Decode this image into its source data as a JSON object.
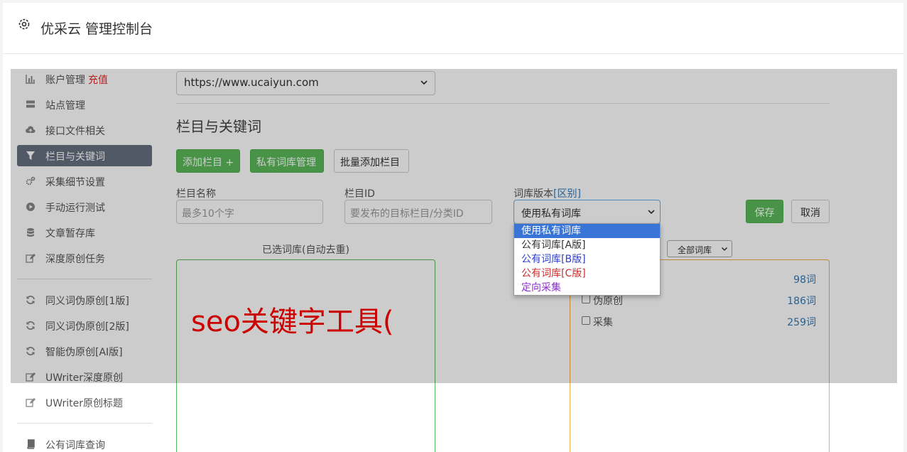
{
  "app": {
    "title": "优采云 管理控制台"
  },
  "sidebar": {
    "group1": [
      {
        "label": "账户管理",
        "badge": "充值",
        "icon": "bar-chart-icon"
      },
      {
        "label": "站点管理",
        "icon": "server-icon"
      },
      {
        "label": "接口文件相关",
        "icon": "cloud-upload-icon"
      },
      {
        "label": "栏目与关键词",
        "icon": "filter-icon",
        "active": true
      },
      {
        "label": "采集细节设置",
        "icon": "cogs-icon"
      },
      {
        "label": "手动运行测试",
        "icon": "play-circle-icon"
      },
      {
        "label": "文章暂存库",
        "icon": "database-icon"
      },
      {
        "label": "深度原创任务",
        "icon": "edit-icon"
      }
    ],
    "group2": [
      {
        "label": "同义词伪原创[1版]",
        "icon": "refresh-icon"
      },
      {
        "label": "同义词伪原创[2版]",
        "icon": "refresh-icon"
      },
      {
        "label": "智能伪原创[AI版]",
        "icon": "refresh-icon"
      },
      {
        "label": "UWriter深度原创",
        "icon": "edit-icon"
      },
      {
        "label": "UWriter原创标题",
        "icon": "edit-icon"
      }
    ],
    "group3": [
      {
        "label": "公有词库查询",
        "icon": "book-icon"
      }
    ]
  },
  "main": {
    "site_select": "https://www.ucaiyun.com",
    "section_title": "栏目与关键词",
    "buttons": {
      "add_column": "添加栏目 +",
      "private_lib": "私有词库管理",
      "batch_add": "批量添加栏目",
      "save": "保存",
      "cancel": "取消"
    },
    "form": {
      "name_label": "栏目名称",
      "name_placeholder": "最多10个字",
      "id_label": "栏目ID",
      "id_placeholder": "要发布的目标栏目/分类ID",
      "lib_label": "词库版本",
      "lib_label_link": "[区别]",
      "lib_selected": "使用私有词库"
    },
    "dropdown_options": [
      "使用私有词库",
      "公有词库[A版]",
      "公有词库[B版]",
      "公有词库[C版]",
      "定向采集"
    ],
    "left_panel_title": "已选词库(自动去重)",
    "overlay_text": "seo关键字工具(",
    "filter_select": "全部词库",
    "libraries": [
      {
        "name": "",
        "count": "98词"
      },
      {
        "name": "伪原创",
        "count": "186词"
      },
      {
        "name": "采集",
        "count": "259词"
      }
    ]
  },
  "colors": {
    "accent_green": "#5cb85c",
    "active_nav": "#666e80",
    "badge_red": "#e02a2a",
    "overlay_red": "#ff0000",
    "link_blue": "#337ab7"
  }
}
